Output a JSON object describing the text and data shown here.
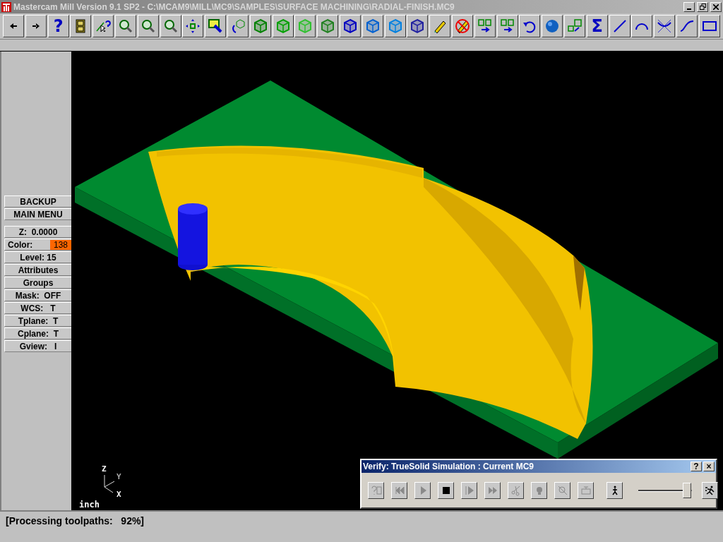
{
  "window": {
    "title": "Mastercam Mill Version 9.1 SP2 - C:\\MCAM9\\MILL\\MC9\\SAMPLES\\SURFACE MACHINING\\RADIAL-FINISH.MC9"
  },
  "toolbar": [
    {
      "kind": "back"
    },
    {
      "kind": "forward"
    },
    {
      "kind": "text",
      "label": "?"
    },
    {
      "kind": "cabinet"
    },
    {
      "kind": "pointer"
    },
    {
      "kind": "zoom"
    },
    {
      "kind": "zoom"
    },
    {
      "kind": "zoom"
    },
    {
      "kind": "pan"
    },
    {
      "kind": "paint"
    },
    {
      "kind": "rotate"
    },
    {
      "kind": "cube",
      "color": "#008000"
    },
    {
      "kind": "cube",
      "color": "#00a000"
    },
    {
      "kind": "cube",
      "color": "#30c030"
    },
    {
      "kind": "cube",
      "color": "#208020"
    },
    {
      "kind": "cube",
      "color": "#0000c0"
    },
    {
      "kind": "cube",
      "color": "#0060d0"
    },
    {
      "kind": "cube",
      "color": "#0080e0"
    },
    {
      "kind": "cube",
      "color": "#2020a0"
    },
    {
      "kind": "pencil"
    },
    {
      "kind": "nopencil"
    },
    {
      "kind": "move"
    },
    {
      "kind": "move"
    },
    {
      "kind": "undo"
    },
    {
      "kind": "sphere"
    },
    {
      "kind": "xform"
    },
    {
      "kind": "text",
      "label": "Σ"
    },
    {
      "kind": "line"
    },
    {
      "kind": "arc"
    },
    {
      "kind": "fillet"
    },
    {
      "kind": "spline"
    },
    {
      "kind": "rect"
    }
  ],
  "menu": {
    "nav": [
      "BACKUP",
      "MAIN MENU"
    ],
    "items": [
      {
        "label": "Z:  0.0000"
      },
      {
        "label": "Color:",
        "value": "138",
        "color": "#ff6600"
      },
      {
        "label": "Level: 15"
      },
      {
        "label": "Attributes"
      },
      {
        "label": "Groups"
      },
      {
        "label": "Mask:  OFF"
      },
      {
        "label": "WCS:   T"
      },
      {
        "label": "Tplane:  T"
      },
      {
        "label": "Cplane:  T"
      },
      {
        "label": "Gview:   I"
      }
    ]
  },
  "viewport": {
    "axes": [
      "Z",
      "Y",
      "X"
    ],
    "units": "inch"
  },
  "verify": {
    "title": "Verify: TrueSolid Simulation : Current MC9",
    "title_buttons": [
      "?",
      "×"
    ],
    "buttons": [
      {
        "kind": "info",
        "disabled": true
      },
      {
        "kind": "rewind",
        "disabled": true
      },
      {
        "kind": "play",
        "disabled": true
      },
      {
        "kind": "stop",
        "disabled": false
      },
      {
        "kind": "step",
        "disabled": true
      },
      {
        "kind": "fast",
        "disabled": true
      },
      {
        "kind": "cutter",
        "disabled": true
      },
      {
        "kind": "light",
        "disabled": true
      },
      {
        "kind": "zoom",
        "disabled": true
      },
      {
        "kind": "machine",
        "disabled": true
      }
    ],
    "walk_button": {
      "disabled": false
    },
    "speed": {
      "level": 0.95
    },
    "run_button": {
      "disabled": false
    }
  },
  "status_bar": "[Processing toolpaths:   92%]"
}
